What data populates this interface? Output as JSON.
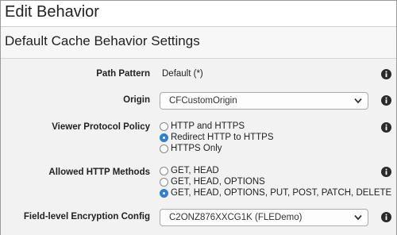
{
  "page": {
    "title": "Edit Behavior"
  },
  "section": {
    "title": "Default Cache Behavior Settings"
  },
  "fields": {
    "path_pattern": {
      "label": "Path Pattern",
      "value": "Default (*)"
    },
    "origin": {
      "label": "Origin",
      "selected": "CFCustomOrigin"
    },
    "viewer_protocol_policy": {
      "label": "Viewer Protocol Policy",
      "options": [
        "HTTP and HTTPS",
        "Redirect HTTP to HTTPS",
        "HTTPS Only"
      ],
      "selected": "Redirect HTTP to HTTPS"
    },
    "allowed_http_methods": {
      "label": "Allowed HTTP Methods",
      "options": [
        "GET, HEAD",
        "GET, HEAD, OPTIONS",
        "GET, HEAD, OPTIONS, PUT, POST, PATCH, DELETE"
      ],
      "selected": "GET, HEAD, OPTIONS, PUT, POST, PATCH, DELETE"
    },
    "field_level_encryption": {
      "label": "Field-level Encryption Config",
      "selected": "C2ONZ876XXCG1K (FLEDemo)"
    }
  },
  "icons": {
    "info": "info-icon",
    "dropdown": "chevron-down-icon",
    "radio_on_color": "#2f7fd6"
  }
}
